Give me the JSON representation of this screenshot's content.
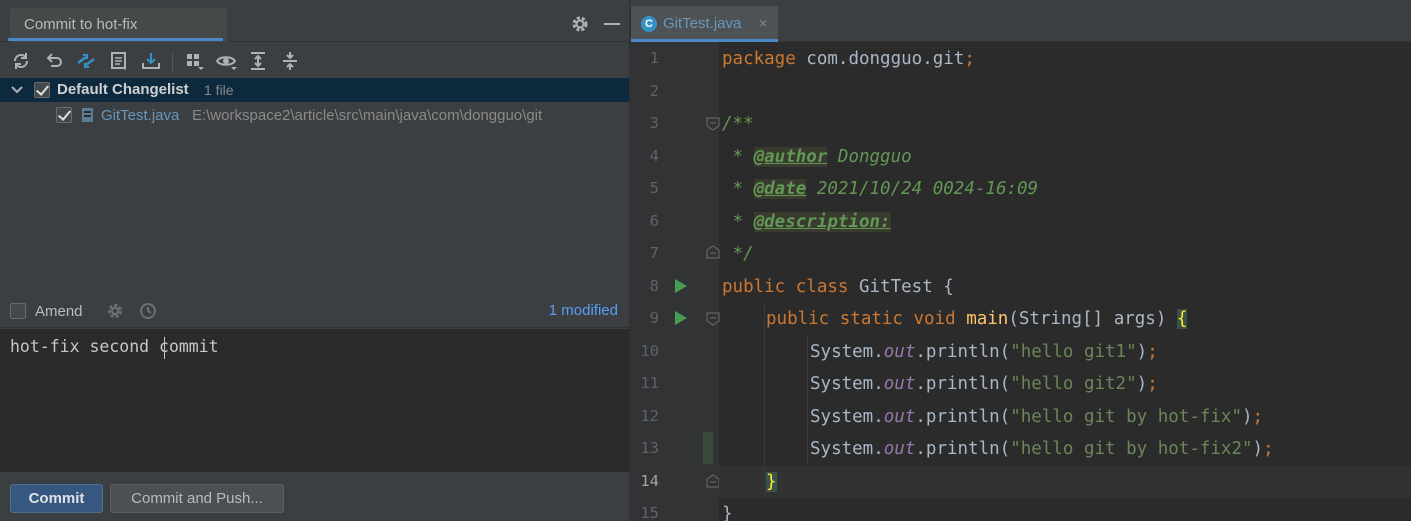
{
  "commit_panel": {
    "tab_title": "Commit to hot-fix",
    "changelist": {
      "label": "Default Changelist",
      "count": "1 file"
    },
    "file": {
      "name": "GitTest.java",
      "path": "E:\\workspace2\\article\\src\\main\\java\\com\\dongguo\\git"
    },
    "amend_label": "Amend",
    "modified_status": "1 modified",
    "message": "hot-fix second commit",
    "commit_label": "Commit",
    "commit_push_label": "Commit and Push..."
  },
  "editor": {
    "tab_title": "GitTest.java",
    "tab_close": "×",
    "line_numbers": [
      "1",
      "2",
      "3",
      "4",
      "5",
      "6",
      "7",
      "8",
      "9",
      "10",
      "11",
      "12",
      "13",
      "14",
      "15"
    ],
    "tokens": {
      "l1_kw": "package",
      "l1_pkg": " com.dongguo.git",
      "l1_semi": ";",
      "l3": "/**",
      "l4_pre": " * ",
      "l4_tag": "@author",
      "l4_val": " Dongguo",
      "l5_pre": " * ",
      "l5_tag": "@date",
      "l5_val": " 2021/10/24 0024-16:09",
      "l6_pre": " * ",
      "l6_tag": "@description:",
      "l7": " */",
      "l8_kw": "public class",
      "l8_rest": " GitTest {",
      "l9_kw": "public static void",
      "l9_fn": " main",
      "l9_rest": "(String[] args) ",
      "l9_brace": "{",
      "sys": "System.",
      "out": "out",
      "println": ".println(",
      "s10": "\"hello git1\"",
      "s11": "\"hello git2\"",
      "s12": "\"hello git by hot-fix\"",
      "s13": "\"hello git by hot-fix2\"",
      "close_paren": ")",
      "semi": ";",
      "l14_brace": "}",
      "l15_brace": "}"
    }
  },
  "colors": {
    "accent": "#4a88c7",
    "commit_button": "#365880",
    "run_icon": "#499c54",
    "keyword": "#cc7832",
    "string": "#6a8759",
    "doc_comment": "#629755"
  },
  "icons": [
    "refresh-icon",
    "rollback-icon",
    "merge-icon",
    "show-diff-icon",
    "shelve-icon",
    "group-by-icon",
    "eye-icon",
    "expand-all-icon",
    "collapse-all-icon",
    "gear-icon",
    "minimize-icon",
    "history-clock-icon",
    "run-gutter-icon",
    "fold-icon"
  ]
}
